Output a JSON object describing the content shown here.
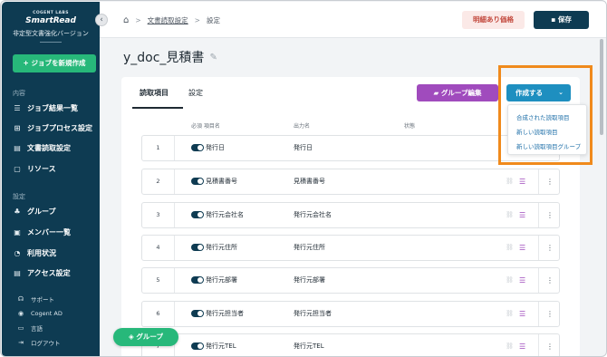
{
  "sidebar": {
    "logo_small": "COGENT LABS",
    "logo_main": "SmartRead",
    "logo_sub": "非定型文書強化バージョン",
    "new_job_label": "+ ジョブを新規作成",
    "section_content": "内容",
    "content_items": [
      {
        "label": "ジョブ結果一覧",
        "icon": "list-icon"
      },
      {
        "label": "ジョブプロセス設定",
        "icon": "process-icon"
      },
      {
        "label": "文書読取設定",
        "icon": "document-icon"
      },
      {
        "label": "リソース",
        "icon": "resource-icon"
      }
    ],
    "section_settings": "設定",
    "settings_items": [
      {
        "label": "グループ",
        "icon": "group-icon"
      },
      {
        "label": "メンバー一覧",
        "icon": "members-icon"
      },
      {
        "label": "利用状況",
        "icon": "usage-icon"
      },
      {
        "label": "アクセス設定",
        "icon": "access-icon"
      }
    ],
    "util_items": [
      {
        "label": "サポート",
        "icon": "support-icon"
      },
      {
        "label": "Cogent AD",
        "icon": "user-icon"
      },
      {
        "label": "言語",
        "icon": "language-icon"
      },
      {
        "label": "ログアウト",
        "icon": "logout-icon"
      }
    ]
  },
  "topbar": {
    "breadcrumb_link": "文書読取設定",
    "breadcrumb_current": "設定",
    "estimate_label": "明細あり価格",
    "save_label": "保存"
  },
  "doc_title": "y_doc_見積書",
  "tabs": [
    "読取項目",
    "設定"
  ],
  "actions": {
    "group_edit_label": "グループ編集",
    "create_label": "作成する"
  },
  "dropdown_options": [
    "合成された読取項目",
    "新しい読取項目",
    "新しい読取項目グループ"
  ],
  "columns": {
    "required_item": "必須 項目名",
    "output": "出力名",
    "status": "状態"
  },
  "rows": [
    {
      "num": "1",
      "name": "発行日",
      "output": "発行日"
    },
    {
      "num": "2",
      "name": "見積書番号",
      "output": "見積書番号"
    },
    {
      "num": "3",
      "name": "発行元会社名",
      "output": "発行元会社名"
    },
    {
      "num": "4",
      "name": "発行元住所",
      "output": "発行元住所"
    },
    {
      "num": "5",
      "name": "発行元部署",
      "output": "発行元部署"
    },
    {
      "num": "6",
      "name": "発行元担当者",
      "output": "発行元担当者"
    },
    {
      "num": "7",
      "name": "発行元TEL",
      "output": "発行元TEL"
    }
  ],
  "float_group_label": "グループ",
  "colors": {
    "sidebar": "#0e3b52",
    "accent_green": "#27b87a",
    "purple": "#a04bbd",
    "blue": "#1e8fc0",
    "highlight": "#f08a1c"
  }
}
